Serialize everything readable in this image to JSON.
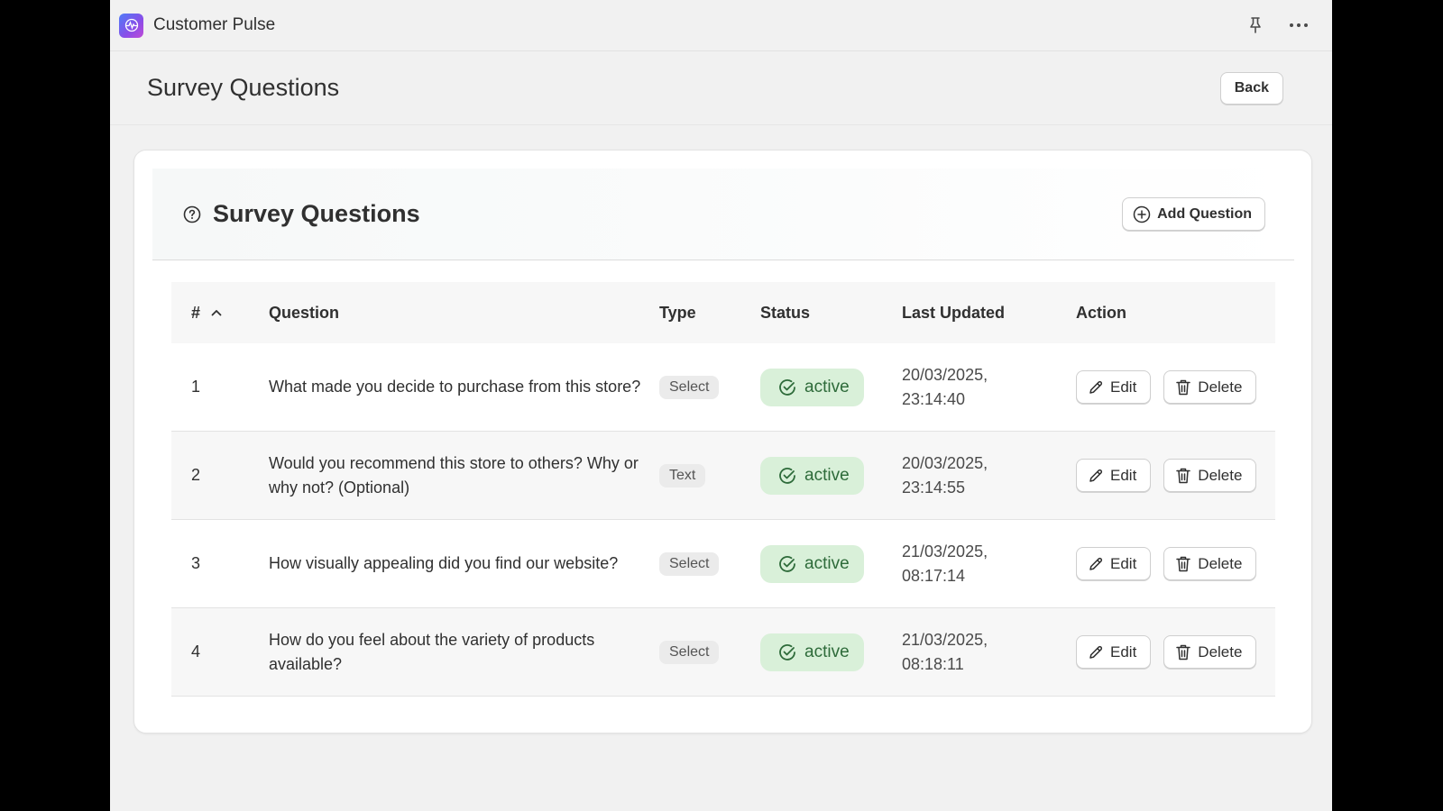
{
  "app": {
    "name": "Customer Pulse"
  },
  "titlebar": {
    "pin_icon": "pin-icon",
    "more_icon": "more-horizontal-icon"
  },
  "page": {
    "title": "Survey Questions",
    "back_label": "Back"
  },
  "card": {
    "title": "Survey Questions",
    "title_icon": "question-circle-icon",
    "add_label": "Add Question"
  },
  "table": {
    "headers": {
      "num": "#",
      "question": "Question",
      "type": "Type",
      "status": "Status",
      "updated": "Last Updated",
      "action": "Action"
    },
    "sort_icon": "chevron-up-icon",
    "rows": [
      {
        "num": "1",
        "question": "What made you decide to purchase from this store?",
        "type": "Select",
        "status": "active",
        "date": "20/03/2025,",
        "time": "23:14:40",
        "edit": "Edit",
        "delete": "Delete"
      },
      {
        "num": "2",
        "question": "Would you recommend this store to others? Why or why not? (Optional)",
        "type": "Text",
        "status": "active",
        "date": "20/03/2025,",
        "time": "23:14:55",
        "edit": "Edit",
        "delete": "Delete"
      },
      {
        "num": "3",
        "question": "How visually appealing did you find our website?",
        "type": "Select",
        "status": "active",
        "date": "21/03/2025,",
        "time": "08:17:14",
        "edit": "Edit",
        "delete": "Delete"
      },
      {
        "num": "4",
        "question": "How do you feel about the variety of products available?",
        "type": "Select",
        "status": "active",
        "date": "21/03/2025,",
        "time": "08:18:11",
        "edit": "Edit",
        "delete": "Delete"
      }
    ]
  },
  "colors": {
    "active_bg": "#d9f0d9",
    "active_text": "#2e6b3a",
    "page_bg": "#f1f1f1"
  }
}
